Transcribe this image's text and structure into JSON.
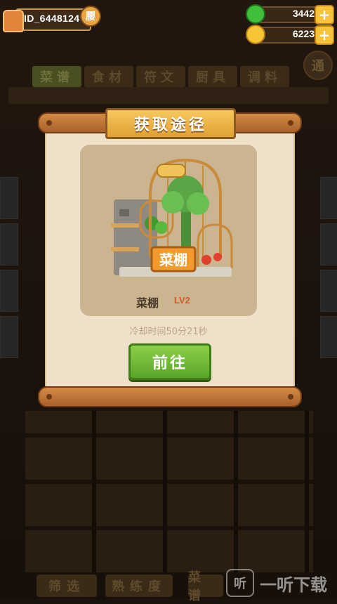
{
  "player": {
    "id": "ID_6448124",
    "rank_badge": "腰"
  },
  "currencies": {
    "gems": {
      "value": "3442",
      "icon": "gem-icon",
      "add": "+"
    },
    "coins": {
      "value": "6223",
      "icon": "coin-icon",
      "add": "+"
    }
  },
  "background": {
    "tabs": [
      "菜谱",
      "食材",
      "符文",
      "厨具",
      "调料"
    ],
    "round_button": "通",
    "bottom_buttons": [
      "筛选",
      "熟练度",
      "菜谱"
    ]
  },
  "popup": {
    "title": "获取途径",
    "item_name": "菜棚",
    "item_level": "LV2",
    "sign_label": "菜棚",
    "cooldown": "冷却时间50分21秒",
    "button": "前往"
  },
  "watermark": {
    "logo": "听",
    "text": "一听下载"
  },
  "colors": {
    "accent_green": "#5aa526",
    "title_gold": "#e0a034",
    "level_red": "#cf5a2a"
  }
}
